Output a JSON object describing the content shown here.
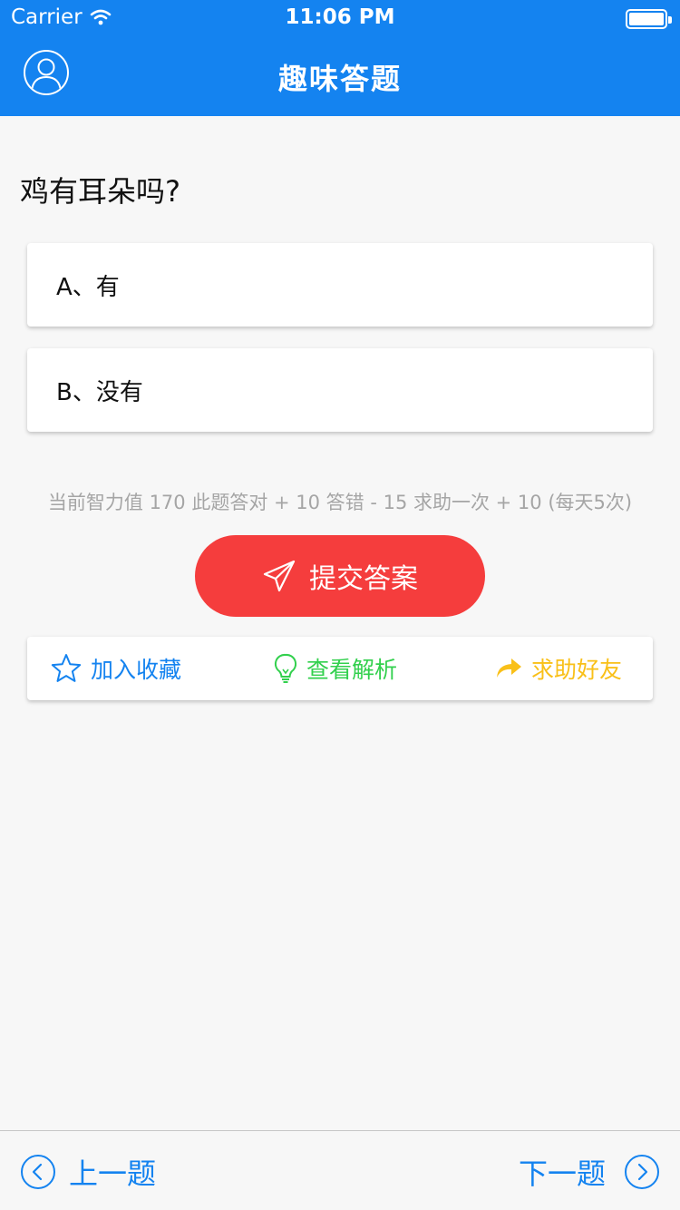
{
  "status_bar": {
    "carrier": "Carrier",
    "time": "11:06 PM"
  },
  "nav": {
    "title": "趣味答题"
  },
  "quiz": {
    "question": "鸡有耳朵吗?",
    "options": [
      {
        "label": "A、有"
      },
      {
        "label": "B、没有"
      }
    ],
    "score_info": "当前智力值 170 此题答对 + 10 答错 - 15 求助一次 + 10 (每天5次)",
    "submit_label": "提交答案"
  },
  "actions": {
    "favorite_label": "加入收藏",
    "analysis_label": "查看解析",
    "help_label": "求助好友"
  },
  "footer": {
    "prev_label": "上一题",
    "next_label": "下一题"
  },
  "colors": {
    "brand_blue": "#1483f0",
    "submit_red": "#f53d3d",
    "analysis_green": "#32d04d",
    "help_yellow": "#f9c019",
    "muted_gray": "#a5a5a5"
  }
}
